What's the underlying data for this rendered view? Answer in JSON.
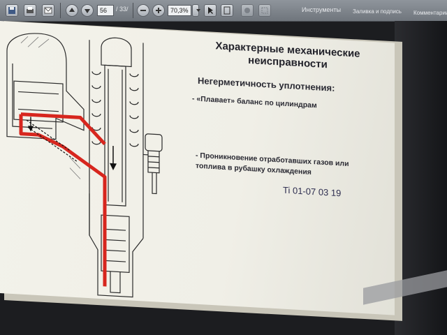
{
  "toolbar": {
    "page_current": "56",
    "page_total": "/ 33/",
    "zoom": "70,3%",
    "tabs": [
      "Инструменты",
      "Заливка и подпись",
      "Комментарии"
    ]
  },
  "slide": {
    "title_line1": "Характерные механические",
    "title_line2": "неисправности",
    "subtitle": "Негерметичность уплотнения:",
    "bullet1": "- «Плавает» баланс по цилиндрам",
    "bullet2_line1": "- Проникновение отработавших газов или",
    "bullet2_line2": "топлива в рубашку охлаждения",
    "code": "Ti 01-07 03 19"
  },
  "colors": {
    "accent_red": "#d7261e",
    "slide_bg": "#f1f0e8",
    "text_dark": "#25252d"
  },
  "icons": [
    "save-icon",
    "print-icon",
    "mail-icon",
    "page-up-icon",
    "page-down-icon",
    "zoom-out-icon",
    "zoom-in-icon",
    "select-tool-icon",
    "fit-page-icon"
  ]
}
